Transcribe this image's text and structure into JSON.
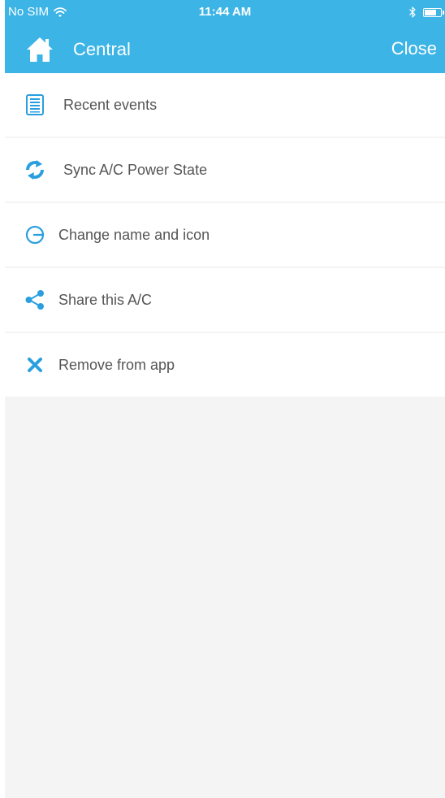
{
  "status_bar": {
    "carrier": "No SIM",
    "time": "11:44 AM",
    "battery_level": 0.85,
    "icons": [
      "wifi-icon",
      "bluetooth-icon",
      "battery-icon"
    ]
  },
  "nav": {
    "title": "Central",
    "close_label": "Close",
    "icon": "home-icon"
  },
  "colors": {
    "accent": "#3cb4e6",
    "menu_icon": "#2a9fe0",
    "background": "#f4f4f4",
    "item_background": "#ffffff",
    "label_text": "#555555"
  },
  "menu": {
    "items": [
      {
        "label": "Recent events",
        "icon": "list-document-icon"
      },
      {
        "label": "Sync A/C Power State",
        "icon": "sync-arrows-icon"
      },
      {
        "label": "Change name and icon",
        "icon": "edit-circle-icon"
      },
      {
        "label": "Share this A/C",
        "icon": "share-icon"
      },
      {
        "label": "Remove from app",
        "icon": "close-x-icon"
      }
    ]
  }
}
